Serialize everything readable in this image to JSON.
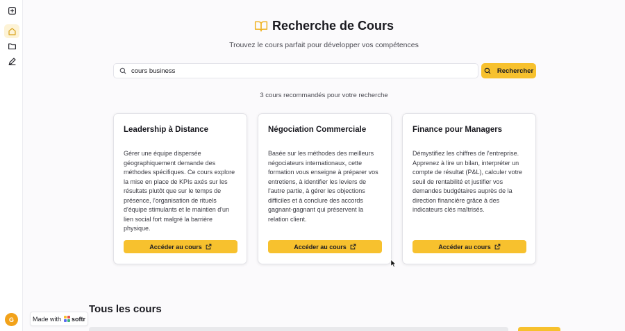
{
  "colors": {
    "accent": "#f7c12e",
    "accent_icon": "#f0b323",
    "avatar": "#f2a21a",
    "active_bg": "#fdf3d6"
  },
  "sidebar": {
    "items": [
      {
        "icon": "add-square-icon"
      },
      {
        "icon": "home-icon",
        "active": true
      },
      {
        "icon": "folder-icon"
      },
      {
        "icon": "pen-icon"
      }
    ],
    "avatar_initial": "G"
  },
  "badge": {
    "made_with": "Made with",
    "brand": "softr"
  },
  "header": {
    "icon": "open-book-icon",
    "title": "Recherche de Cours",
    "subtitle": "Trouvez le cours parfait pour développer vos compétences"
  },
  "search": {
    "value": "cours business",
    "button_label": "Rechercher"
  },
  "results": {
    "count_text": "3 cours recommandés pour votre recherche"
  },
  "courses": [
    {
      "title": "Leadership à Distance",
      "description": "Gérer une équipe dispersée géographiquement demande des méthodes spécifiques. Ce cours explore la mise en place de KPIs axés sur les résultats plutôt que sur le temps de présence, l'organisation de rituels d'équipe stimulants et le maintien d'un lien social fort malgré la barrière physique.",
      "button_label": "Accéder au cours"
    },
    {
      "title": "Négociation Commerciale",
      "description": "Basée sur les méthodes des meilleurs négociateurs internationaux, cette formation vous enseigne à préparer vos entretiens, à identifier les leviers de l'autre partie, à gérer les objections difficiles et à conclure des accords gagnant-gagnant qui préservent la relation client.",
      "button_label": "Accéder au cours"
    },
    {
      "title": "Finance pour Managers",
      "description": "Démystifiez les chiffres de l'entreprise. Apprenez à lire un bilan, interpréter un compte de résultat (P&L), calculer votre seuil de rentabilité et justifier vos demandes budgétaires auprès de la direction financière grâce à des indicateurs clés maîtrisés.",
      "button_label": "Accéder au cours"
    }
  ],
  "all_courses": {
    "title": "Tous les cours"
  }
}
